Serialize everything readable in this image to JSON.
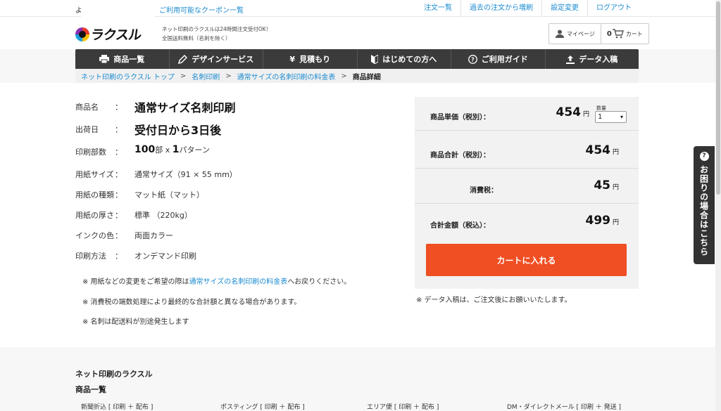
{
  "topbar": {
    "stub": "よ",
    "coupon_link": "ご利用可能なクーポン一覧",
    "links": [
      "注文一覧",
      "過去の注文から増刷",
      "設定変更",
      "ログアウト"
    ]
  },
  "header": {
    "logo_text": "ラクスル",
    "tagline_line1": "ネット印刷のラクスルは24時間注文受付OK！",
    "tagline_line2": "全国送料無料（名刺を除く）",
    "mypage": "マイページ",
    "cart_count": "0",
    "cart": "カート"
  },
  "gnav": [
    {
      "label": "商品一覧",
      "icon": "printer-icon"
    },
    {
      "label": "デザインサービス",
      "icon": "pen-icon"
    },
    {
      "label": "見積もり",
      "icon": "yen-icon"
    },
    {
      "label": "はじめての方へ",
      "icon": "beginner-mark-icon"
    },
    {
      "label": "ご利用ガイド",
      "icon": "question-icon"
    },
    {
      "label": "データ入稿",
      "icon": "upload-icon"
    }
  ],
  "breadcrumb": {
    "items": [
      "ネット印刷のラクスル トップ",
      "名刺印刷",
      "通常サイズの名刺印刷の料金表"
    ],
    "separator": ">",
    "current": "商品詳細"
  },
  "specs": {
    "product_label": "商品名",
    "product_value": "通常サイズ名刺印刷",
    "ship_label": "出荷日",
    "ship_value": "受付日から3日後",
    "count_label": "印刷部数",
    "count_num": "100",
    "count_unit": "部",
    "count_x": " x ",
    "pattern_num": "1",
    "pattern_unit": "パターン",
    "size_label": "用紙サイズ",
    "size_value": "通常サイズ（91 × 55 mm）",
    "type_label": "用紙の種類",
    "type_value": "マット紙（マット）",
    "thick_label": "用紙の厚さ",
    "thick_value": "標準 （220kg）",
    "ink_label": "インクの色",
    "ink_value": "両面カラー",
    "method_label": "印刷方法",
    "method_value": "オンデマンド印刷",
    "colon": "："
  },
  "notes": {
    "note1_pre": "※ 用紙などの変更をご希望の際は",
    "note1_link": "通常サイズの名刺印刷の料金表",
    "note1_post": "へお戻りください。",
    "note2": "※ 消費税の端数処理により最終的な合計額と異なる場合があります。",
    "note3": "※ 名刺は配送料が別途発生します"
  },
  "price": {
    "unit_label": "商品単価（税別）：",
    "unit_value": "454",
    "qty_label": "数量",
    "qty_value": "1",
    "subtotal_label": "商品合計（税別）：",
    "subtotal_value": "454",
    "tax_label": "消費税：",
    "tax_value": "45",
    "total_label": "合計金額（税込）：",
    "total_value": "499",
    "yen": "円",
    "cart_button": "カートに入れる",
    "data_note": "※ データ入稿は、ご注文後にお願いいたします。"
  },
  "side_tab": {
    "icon": "?",
    "label": "お困りの場合はこちら"
  },
  "footer": {
    "title": "ネット印刷のラクスル",
    "subtitle": "商品一覧",
    "links": [
      "新聞折込 [ 印刷 ＋ 配布 ]",
      "ポスティング [ 印刷 ＋ 配布 ]",
      "エリア便 [ 印刷 ＋ 配布 ]",
      "DM・ダイレクトメール [ 印刷 ＋ 発送 ]"
    ]
  }
}
